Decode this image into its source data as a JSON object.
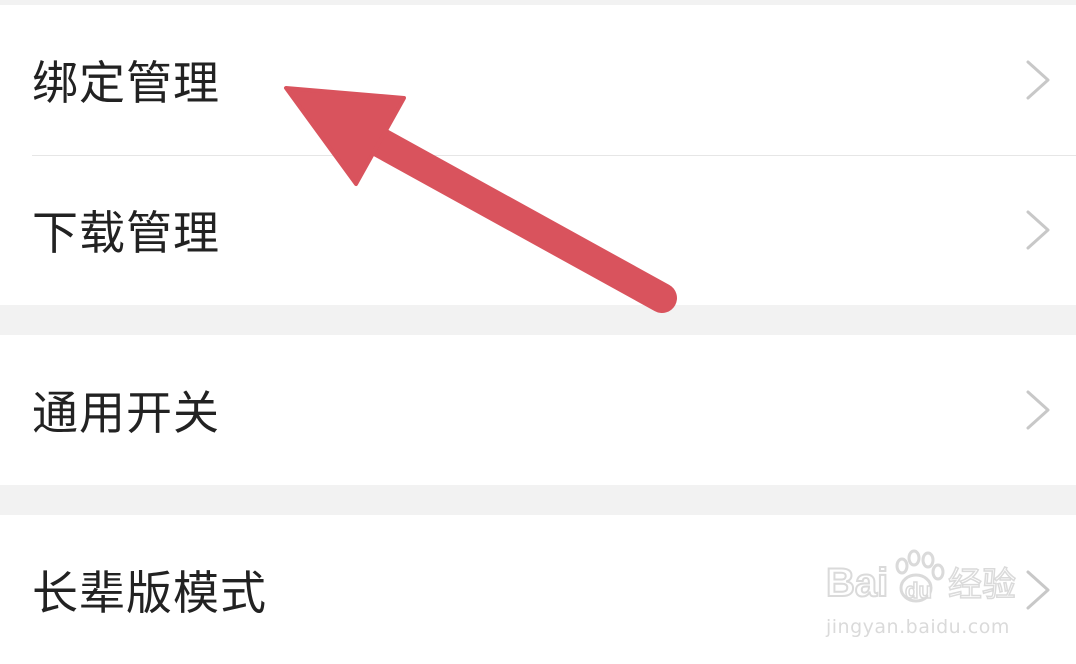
{
  "settings": {
    "items": [
      {
        "label": "绑定管理"
      },
      {
        "label": "下载管理"
      },
      {
        "label": "通用开关"
      },
      {
        "label": "长辈版模式"
      }
    ]
  },
  "icons": {
    "row_chevron": "chevron-right-icon",
    "annotation": "red-arrow-annotation"
  },
  "colors": {
    "annotation_arrow": "#d9535d",
    "chevron": "#c8c8c8",
    "background": "#f2f2f2",
    "row_background": "#ffffff",
    "label_text": "#222222"
  },
  "watermark": {
    "url": "jingyan.baidu.com",
    "logo_text": "Bai du 经验"
  }
}
